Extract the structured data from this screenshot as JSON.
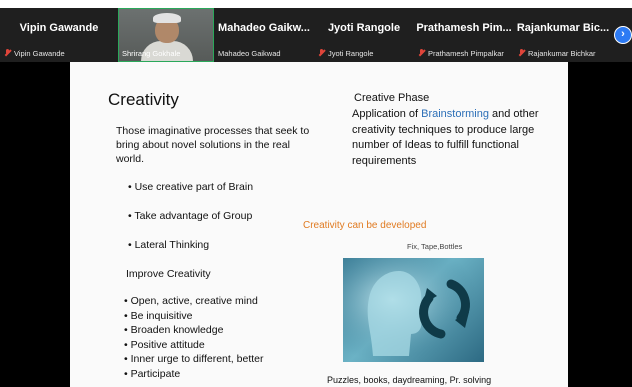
{
  "participants": [
    {
      "display_name": "Vipin Gawande",
      "tag_name": "Vipin Gawande",
      "muted": true
    },
    {
      "display_name": "",
      "tag_name": "Shrirang Gokhale",
      "muted": false,
      "video": true
    },
    {
      "display_name": "Mahadeo Gaikw...",
      "tag_name": "Mahadeo Gaikwad",
      "muted": false
    },
    {
      "display_name": "Jyoti Rangole",
      "tag_name": "Jyoti Rangole",
      "muted": true
    },
    {
      "display_name": "Prathamesh Pim...",
      "tag_name": "Prathamesh Pimpalkar",
      "muted": true
    },
    {
      "display_name": "Rajankumar Bic...",
      "tag_name": "Rajankumar Bichkar",
      "muted": true
    }
  ],
  "next_icon": "chevron-right-icon",
  "slide": {
    "title": "Creativity",
    "definition": "Those imaginative processes that seek to bring about novel solutions in the real world.",
    "points": [
      "• Use creative part of Brain",
      "• Take advantage of Group",
      "• Lateral Thinking"
    ],
    "improve_heading": "Improve Creativity",
    "improve_list": [
      "• Open, active, creative mind",
      "• Be inquisitive",
      "• Broaden knowledge",
      "• Positive attitude",
      "• Inner urge to different, better",
      "• Participate"
    ],
    "phase_heading": "Creative Phase",
    "phase_prefix": "Application of ",
    "phase_keyword": "Brainstorming",
    "phase_rest": " and other creativity techniques to produce large number of Ideas to fulfill functional requirements",
    "developed": "Creativity can be developed",
    "fix_note": "Fix, Tape,Bottles",
    "caption": "Puzzles, books, daydreaming, Pr. solving"
  },
  "colors": {
    "keyword": "#2c6fb7",
    "developed": "#e07b22",
    "muted_mic": "#e0453a",
    "active_speaker": "#2aa85a",
    "next_button": "#2d7bf4"
  }
}
